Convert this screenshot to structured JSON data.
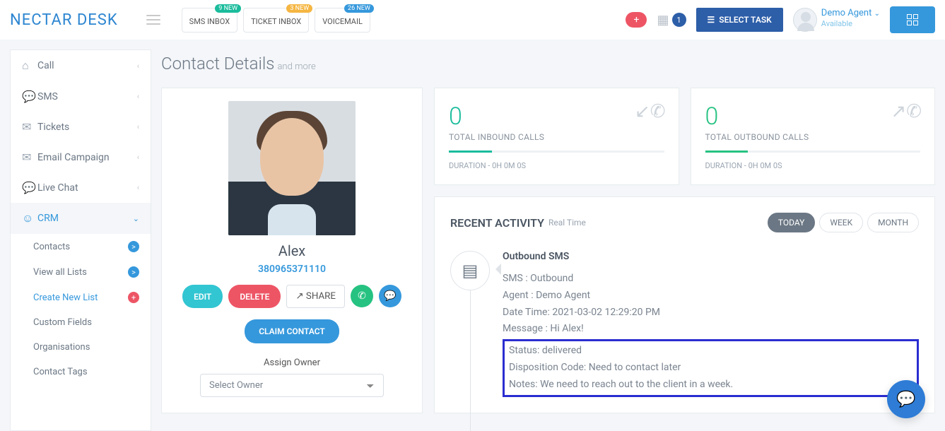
{
  "header": {
    "logo": "NECTAR DESK",
    "inboxes": [
      {
        "label": "SMS INBOX",
        "badge": "9 NEW",
        "badge_class": "badge-teal"
      },
      {
        "label": "TICKET INBOX",
        "badge": "3 NEW",
        "badge_class": "badge-yellow"
      },
      {
        "label": "VOICEMAIL",
        "badge": "26 NEW",
        "badge_class": "badge-blue"
      }
    ],
    "calendar_badge": "1",
    "select_task": "SELECT TASK",
    "user_name": "Demo Agent",
    "user_status": "Available"
  },
  "sidebar": {
    "items": [
      {
        "icon": "⌂",
        "label": "Call"
      },
      {
        "icon": "💬",
        "label": "SMS"
      },
      {
        "icon": "✉",
        "label": "Tickets"
      },
      {
        "icon": "✉",
        "label": "Email Campaign"
      },
      {
        "icon": "💬",
        "label": "Live Chat"
      }
    ],
    "crm_label": "CRM",
    "crm_icon": "👤",
    "subs": [
      {
        "label": "Contacts",
        "dot": ">",
        "dot_class": "dot-blue",
        "active": false
      },
      {
        "label": "View all Lists",
        "dot": ">",
        "dot_class": "dot-blue",
        "active": false
      },
      {
        "label": "Create New List",
        "dot": "+",
        "dot_class": "dot-red",
        "active": true
      },
      {
        "label": "Custom Fields",
        "dot": "",
        "dot_class": "",
        "active": false
      },
      {
        "label": "Organisations",
        "dot": "",
        "dot_class": "",
        "active": false
      },
      {
        "label": "Contact Tags",
        "dot": "",
        "dot_class": "",
        "active": false
      }
    ]
  },
  "page": {
    "title": "Contact Details",
    "subtitle": "and more"
  },
  "contact": {
    "name": "Alex",
    "phone": "380965371110",
    "edit": "EDIT",
    "delete": "DELETE",
    "share": "SHARE",
    "claim": "CLAIM CONTACT",
    "assign_label": "Assign Owner",
    "assign_placeholder": "Select Owner"
  },
  "stats": {
    "inbound": {
      "num": "0",
      "label": "TOTAL INBOUND CALLS",
      "sub": "DURATION - 0H 0M 0S"
    },
    "outbound": {
      "num": "0",
      "label": "TOTAL OUTBOUND CALLS",
      "sub": "DURATION - 0H 0M 0S"
    }
  },
  "activity": {
    "title": "RECENT ACTIVITY",
    "subtitle": "Real Time",
    "tabs": [
      "TODAY",
      "WEEK",
      "MONTH"
    ],
    "active_tab": 0,
    "item": {
      "title": "Outbound SMS",
      "lines": [
        "SMS : Outbound",
        "Agent : Demo Agent",
        "Date Time: 2021-03-02 12:29:20 PM",
        "Message : Hi Alex!"
      ],
      "highlight": [
        "Status: delivered",
        "Disposition Code: Need to contact later",
        "Notes: We need to reach out to the client in a week."
      ]
    }
  }
}
